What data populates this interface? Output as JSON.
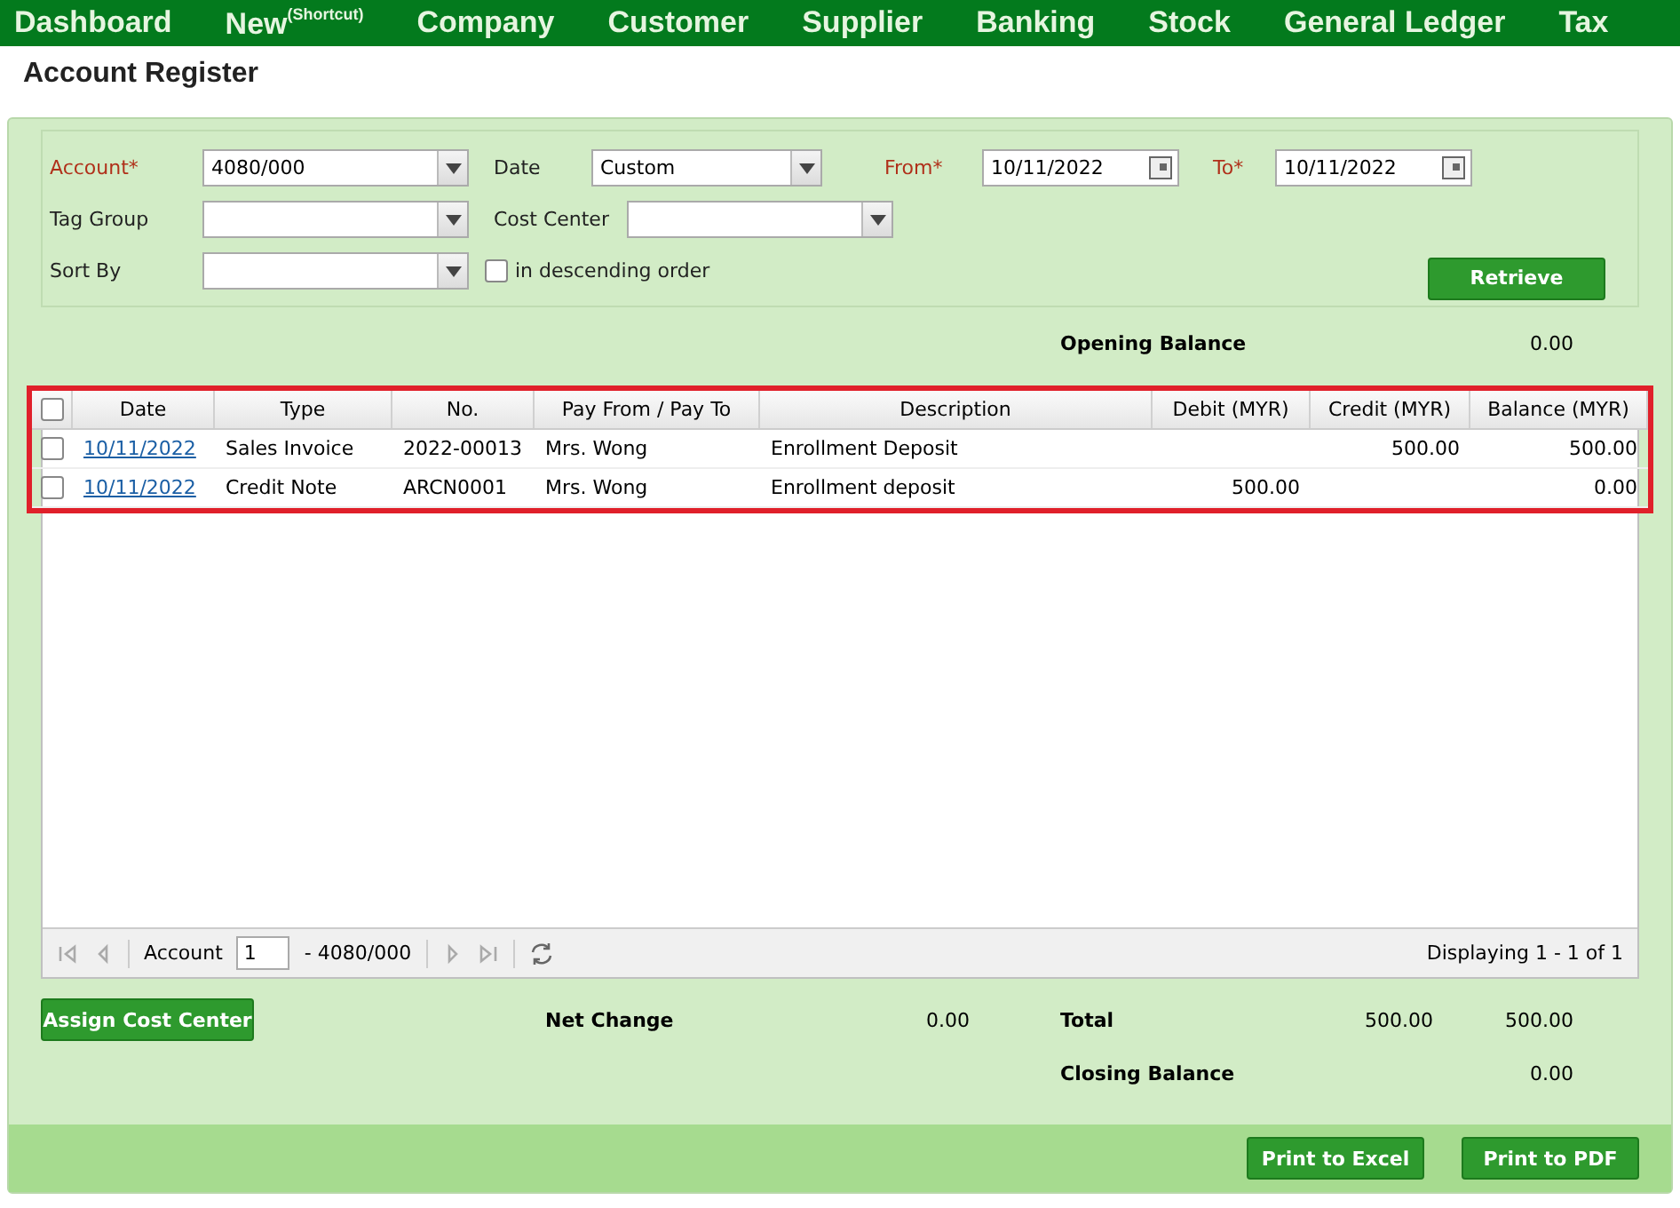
{
  "menu": [
    {
      "label": "Dashboard"
    },
    {
      "label": "New$^{(Shortcut)}$"
    },
    {
      "label": "Company"
    },
    {
      "label": "Customer"
    },
    {
      "label": "Supplier"
    },
    {
      "label": "Banking"
    },
    {
      "label": "Stock"
    },
    {
      "label": "General Ledger"
    },
    {
      "label": "Tax"
    }
  ],
  "page_title": "Account Register",
  "filters": {
    "account": {
      "label": "Account*",
      "value": "4080/000",
      "required": true
    },
    "date": {
      "label": "Date",
      "value": "Custom",
      "required": false
    },
    "from": {
      "label": "From*",
      "value": "10/11/2022",
      "required": true
    },
    "to": {
      "label": "To*",
      "value": "10/11/2022",
      "required": true
    },
    "tag_group": {
      "label": "Tag Group",
      "required": false
    },
    "cost_center": {
      "label": "Cost Center",
      "required": false
    },
    "sort_by": {
      "label": "Sort By",
      "required": false
    },
    "descending": {
      "label": "in descending order",
      "checked": false
    },
    "retrieve_button": "Retrieve"
  },
  "opening_balance": {
    "label": "Opening Balance",
    "value": "0.00"
  },
  "table": {
    "select_all_checked": false,
    "columns": [
      "Date",
      "Type",
      "No.",
      "Pay From / Pay To",
      "Description",
      "Debit (MYR)",
      "Credit (MYR)",
      "Balance (MYR)"
    ],
    "rows": [
      {
        "checked": false,
        "cells": [
          "10/11/2022",
          "Sales Invoice",
          "2022-00013",
          "Mrs. Wong",
          "Enrollment Deposit",
          "",
          "500.00",
          "500.00"
        ]
      },
      {
        "checked": false,
        "cells": [
          "10/11/2022",
          "Credit Note",
          "ARCN0001",
          "Mrs. Wong",
          "Enrollment deposit",
          "500.00",
          "",
          "0.00"
        ]
      }
    ]
  },
  "pager": {
    "label": "Account",
    "page": "1",
    "of": "- 4080/000",
    "displaying": "Displaying 1 - 1 of 1"
  },
  "assign_button": "Assign Cost Center",
  "net_change": {
    "label": "Net Change",
    "value": "0.00"
  },
  "total": {
    "label": "Total",
    "debit": "500.00",
    "credit": "500.00"
  },
  "closing_balance": {
    "label": "Closing Balance",
    "value": "0.00"
  },
  "footer_buttons": [
    "Print to Excel",
    "Print to PDF"
  ]
}
